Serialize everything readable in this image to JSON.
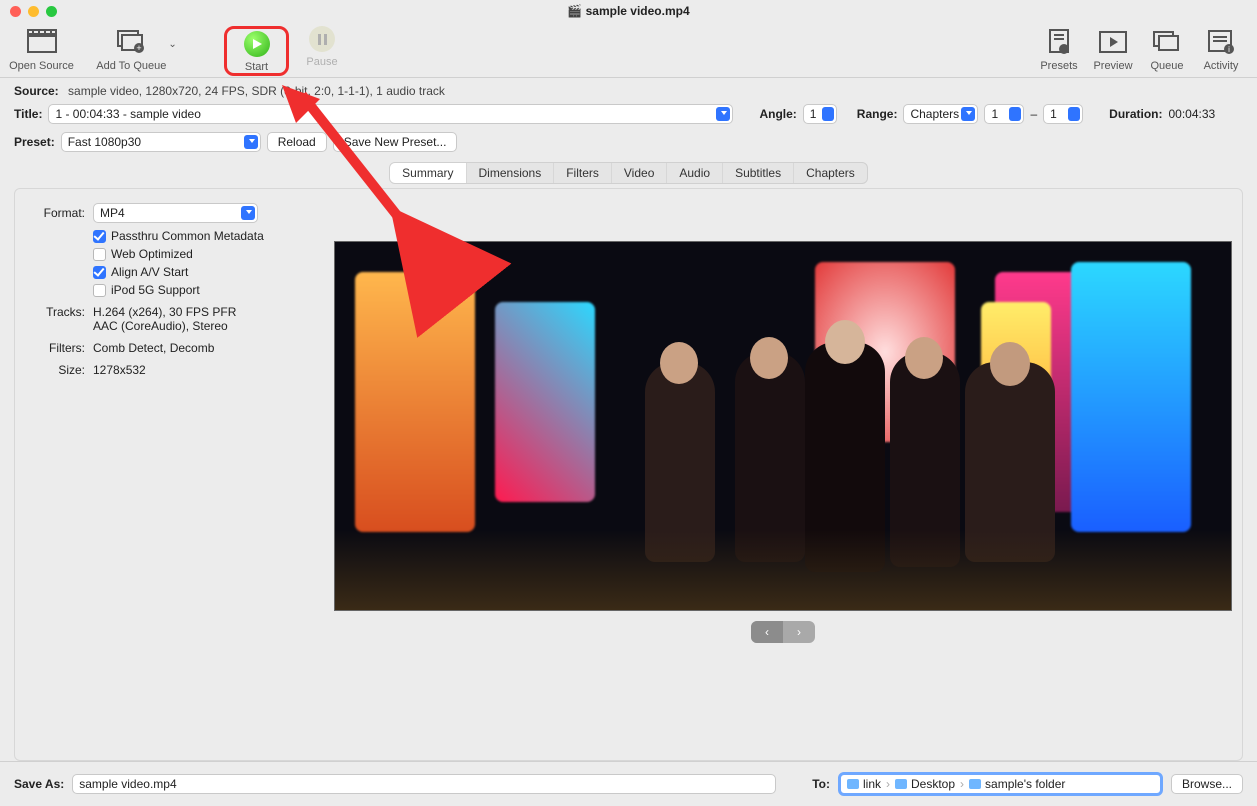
{
  "window": {
    "title": "sample video.mp4"
  },
  "toolbar": {
    "open_source": "Open Source",
    "add_to_queue": "Add To Queue",
    "start": "Start",
    "pause": "Pause",
    "presets": "Presets",
    "preview": "Preview",
    "queue": "Queue",
    "activity": "Activity"
  },
  "source": {
    "label": "Source:",
    "value": "sample video, 1280x720, 24 FPS, SDR (8-bit, 2:0, 1-1-1), 1 audio track"
  },
  "title_row": {
    "label": "Title:",
    "value": "1 - 00:04:33 - sample video",
    "angle_label": "Angle:",
    "angle_value": "1",
    "range_label": "Range:",
    "range_value": "Chapters",
    "range_from": "1",
    "range_dash": "–",
    "range_to": "1",
    "duration_label": "Duration:",
    "duration_value": "00:04:33"
  },
  "preset_row": {
    "label": "Preset:",
    "value": "Fast 1080p30",
    "reload": "Reload",
    "save_new": "Save New Preset..."
  },
  "tabs": [
    "Summary",
    "Dimensions",
    "Filters",
    "Video",
    "Audio",
    "Subtitles",
    "Chapters"
  ],
  "summary": {
    "format_label": "Format:",
    "format_value": "MP4",
    "passthru": "Passthru Common Metadata",
    "web_opt": "Web Optimized",
    "align": "Align A/V Start",
    "ipod": "iPod 5G Support",
    "tracks_label": "Tracks:",
    "tracks_value1": "H.264 (x264), 30 FPS PFR",
    "tracks_value2": "AAC (CoreAudio), Stereo",
    "filters_label": "Filters:",
    "filters_value": "Comb Detect, Decomb",
    "size_label": "Size:",
    "size_value": "1278x532"
  },
  "bottom": {
    "save_as_label": "Save As:",
    "save_as_value": "sample video.mp4",
    "to_label": "To:",
    "path": [
      "link",
      "Desktop",
      "sample's folder"
    ],
    "browse": "Browse..."
  }
}
